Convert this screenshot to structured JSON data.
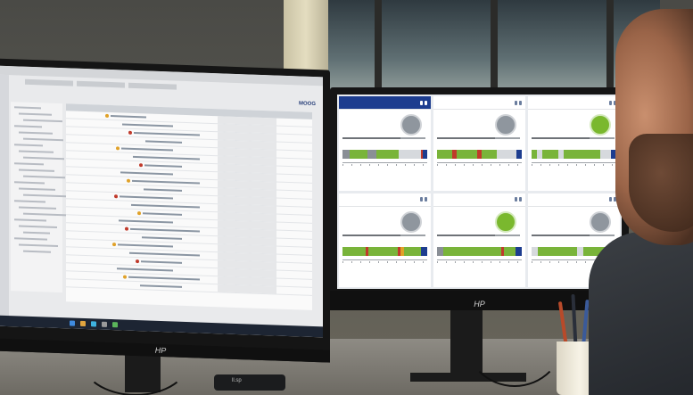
{
  "left_monitor": {
    "brand": "MOOG",
    "logo": "HP",
    "tree_lines": 24,
    "grid_rows": 22
  },
  "right_monitor": {
    "logo": "HP",
    "tiles": [
      {
        "active": true,
        "status": "off",
        "segments": [
          [
            "#8a8f96",
            3
          ],
          [
            "#79b43a",
            8
          ],
          [
            "#8a8f96",
            4
          ],
          [
            "#79b43a",
            10
          ],
          [
            "#d6d9dd",
            10
          ],
          [
            "#c03a2b",
            1
          ],
          [
            "#1d3d8f",
            2
          ]
        ]
      },
      {
        "active": false,
        "status": "off",
        "segments": [
          [
            "#79b43a",
            6
          ],
          [
            "#c03a2b",
            2
          ],
          [
            "#79b43a",
            8
          ],
          [
            "#c03a2b",
            2
          ],
          [
            "#79b43a",
            6
          ],
          [
            "#d6d9dd",
            8
          ],
          [
            "#1d3d8f",
            2
          ]
        ]
      },
      {
        "active": false,
        "status": "on",
        "segments": [
          [
            "#79b43a",
            2
          ],
          [
            "#d6d9dd",
            2
          ],
          [
            "#79b43a",
            6
          ],
          [
            "#d6d9dd",
            2
          ],
          [
            "#79b43a",
            14
          ],
          [
            "#d6d9dd",
            4
          ],
          [
            "#1d3d8f",
            2
          ]
        ]
      },
      {
        "active": false,
        "status": "off",
        "segments": [
          [
            "#79b43a",
            8
          ],
          [
            "#c03a2b",
            1
          ],
          [
            "#79b43a",
            10
          ],
          [
            "#c03a2b",
            1
          ],
          [
            "#e0a128",
            1
          ],
          [
            "#79b43a",
            6
          ],
          [
            "#1d3d8f",
            2
          ]
        ]
      },
      {
        "active": false,
        "status": "on",
        "segments": [
          [
            "#8a8f96",
            2
          ],
          [
            "#79b43a",
            20
          ],
          [
            "#c03a2b",
            1
          ],
          [
            "#79b43a",
            4
          ],
          [
            "#1d3d8f",
            2
          ]
        ]
      },
      {
        "active": false,
        "status": "off",
        "segments": [
          [
            "#d6d9dd",
            2
          ],
          [
            "#79b43a",
            12
          ],
          [
            "#d6d9dd",
            2
          ],
          [
            "#79b43a",
            8
          ],
          [
            "#1d3d8f",
            2
          ]
        ]
      }
    ]
  },
  "device": {
    "label": "ll.sp"
  }
}
